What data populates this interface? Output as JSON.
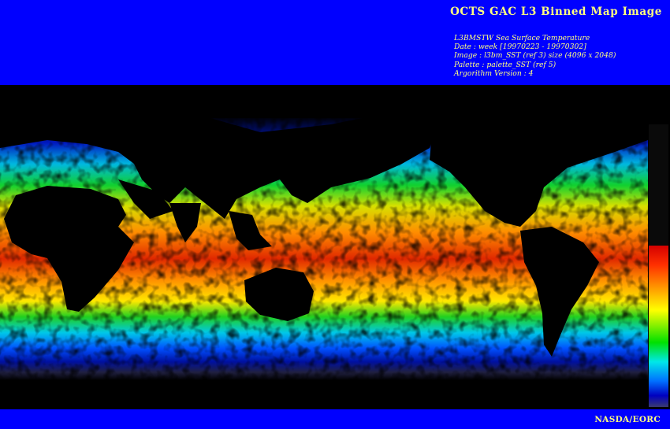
{
  "header": {
    "title": "OCTS GAC L3 Binned Map Image",
    "meta": [
      "L3BMSTW Sea Surface Temperature",
      "Date : week [19970223 - 19970302]",
      "Image : l3bm_SST (ref 3) size (4096 x 2048)",
      "Palette : palette_SST (ref 5)",
      "Argorithm Version : 4"
    ]
  },
  "footer": {
    "credit": "NASDA/EORC"
  },
  "colors": {
    "frame": "#0000ff",
    "text": "#ffff80",
    "land": "#000000",
    "palette": [
      "#d40000",
      "#ff3000",
      "#ff9000",
      "#ffff00",
      "#00e000",
      "#00e8e8",
      "#0070ff",
      "#0000c0"
    ]
  },
  "map": {
    "variable": "Sea Surface Temperature",
    "colorbar": "palette_SST"
  }
}
